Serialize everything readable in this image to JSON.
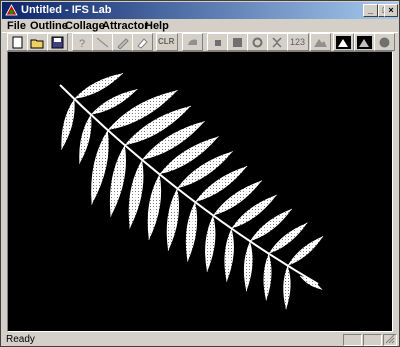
{
  "window": {
    "title": "Untitled - IFS Lab"
  },
  "title_buttons": {
    "minimize": "_",
    "maximize": "□",
    "close": "×"
  },
  "menus": [
    "File",
    "Outline",
    "Collage",
    "Attractor",
    "Help"
  ],
  "menu_underline": [
    "F",
    "O",
    "C",
    "A",
    "H"
  ],
  "toolbar": {
    "clr_label": "CLR",
    "num_label": "123",
    "tools": [
      "new-icon",
      "open-icon",
      "save-icon",
      "help-icon",
      "line-icon",
      "pencil-icon",
      "eraser-icon",
      "clr-button",
      "hand-icon",
      "square-small-icon",
      "square-large-icon",
      "rotate-icon",
      "shrink-icon",
      "number-icon",
      "landscape-icon",
      "mountain-black-icon",
      "mountain-white-icon",
      "dot-icon",
      "color-balls-icon"
    ]
  },
  "status": {
    "text": "Ready"
  },
  "colors": {
    "title_start": "#0a246a",
    "title_end": "#a6caf0",
    "canvas": "#000000",
    "fern": "#ffffff"
  }
}
